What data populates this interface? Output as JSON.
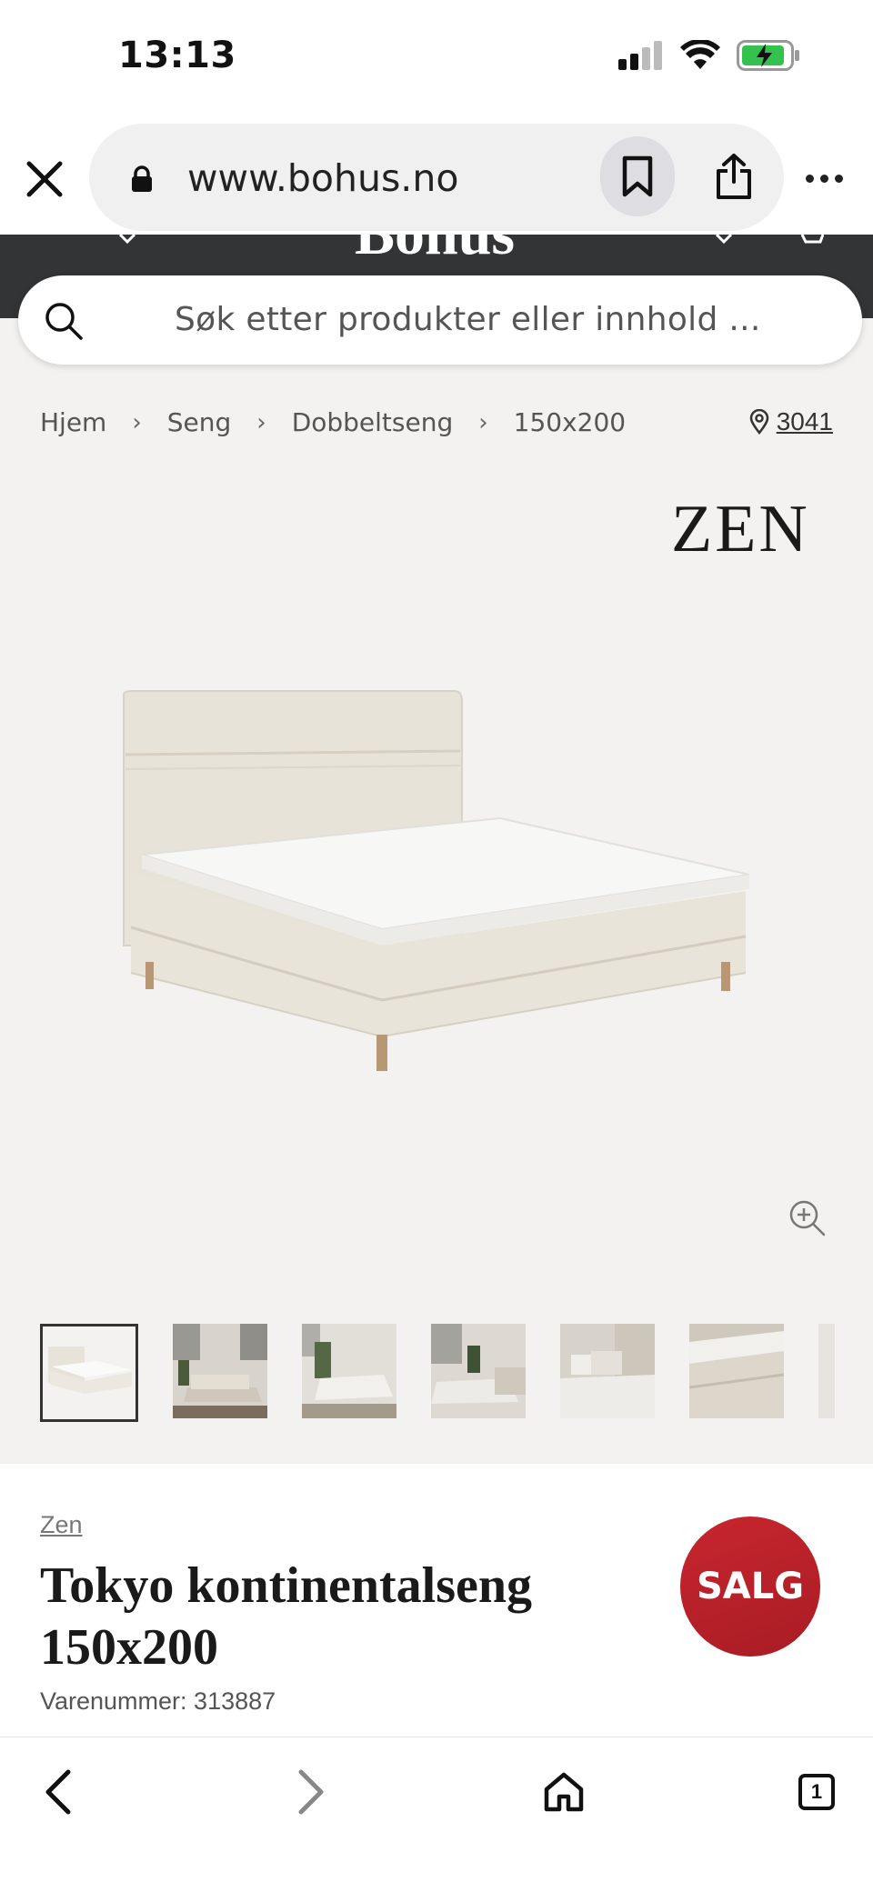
{
  "status": {
    "time": "13:13"
  },
  "browser": {
    "url": "www.bohus.no",
    "tab_count": "1"
  },
  "site": {
    "logo": "Bohus"
  },
  "search": {
    "placeholder": "Søk etter produkter eller innhold ..."
  },
  "breadcrumb": [
    "Hjem",
    "Seng",
    "Dobbeltseng",
    "150x200"
  ],
  "store": {
    "number": "3041"
  },
  "brand": {
    "logo": "ZEN",
    "link": "Zen"
  },
  "product": {
    "title": "Tokyo kontinentalseng 150x200",
    "sku": "Varenummer: 313887",
    "badge": "SALG"
  },
  "thumbnails": [
    "thumb-bed-product",
    "thumb-bedroom-1",
    "thumb-bedroom-2",
    "thumb-bedroom-3",
    "thumb-bed-pillows",
    "thumb-mattress-detail"
  ],
  "colors": {
    "header_dark": "#333435",
    "sale_red": "#c8262e",
    "battery_green": "#33c24d"
  }
}
